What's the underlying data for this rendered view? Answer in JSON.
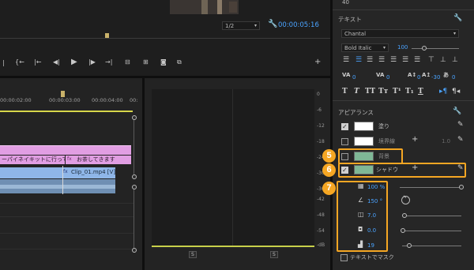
{
  "program": {
    "resolution": "1/2",
    "timecode": "00:00:05:16"
  },
  "timeline": {
    "ruler": [
      "00:00:02:00",
      "00:00:03:00",
      "00:00:04:00",
      "00:"
    ],
    "clips": {
      "graphic_text_1": "ーパイネイキットに行って",
      "graphic_text_2": "お茶してきます",
      "fx_label": "fx",
      "video_clip": "Clip_01.mp4 [V]"
    }
  },
  "meter": {
    "scale": [
      "0",
      "-6",
      "-12",
      "-18",
      "-24",
      "-30",
      "-36",
      "-42",
      "-48",
      "-54",
      "-dB"
    ],
    "solo_left": "S",
    "solo_right": "S"
  },
  "panel": {
    "top_value": "40",
    "text_section": "テキスト",
    "font_name": "Chantal",
    "font_style": "Bold Italic",
    "font_size": "100",
    "kerning_value": "0",
    "tracking_value": "0",
    "leading_value": "0",
    "baseline_value": "-30",
    "tsume_value": "0",
    "appearance_section": "アピアランス",
    "fill_label": "塗り",
    "stroke_label": "境界線",
    "stroke_size": "1.0",
    "background_label": "背景",
    "shadow_label": "シャドウ",
    "opacity_value": "100 %",
    "angle_value": "150 °",
    "distance_value": "7.0",
    "size_value": "0.0",
    "blur_value": "19",
    "mask_label": "テキストでマスク"
  },
  "annotations": {
    "badge_5": "5",
    "badge_6": "6",
    "badge_7": "7"
  },
  "colors": {
    "fill_swatch": "#ffffff",
    "stroke_swatch": "#ffffff",
    "background_swatch": "#7fb896",
    "shadow_swatch": "#7fb896",
    "highlight": "#f5a623",
    "graphic_clip": "#d98cd9",
    "video_clip": "#8db4e6",
    "accent": "#4aa3ff"
  }
}
